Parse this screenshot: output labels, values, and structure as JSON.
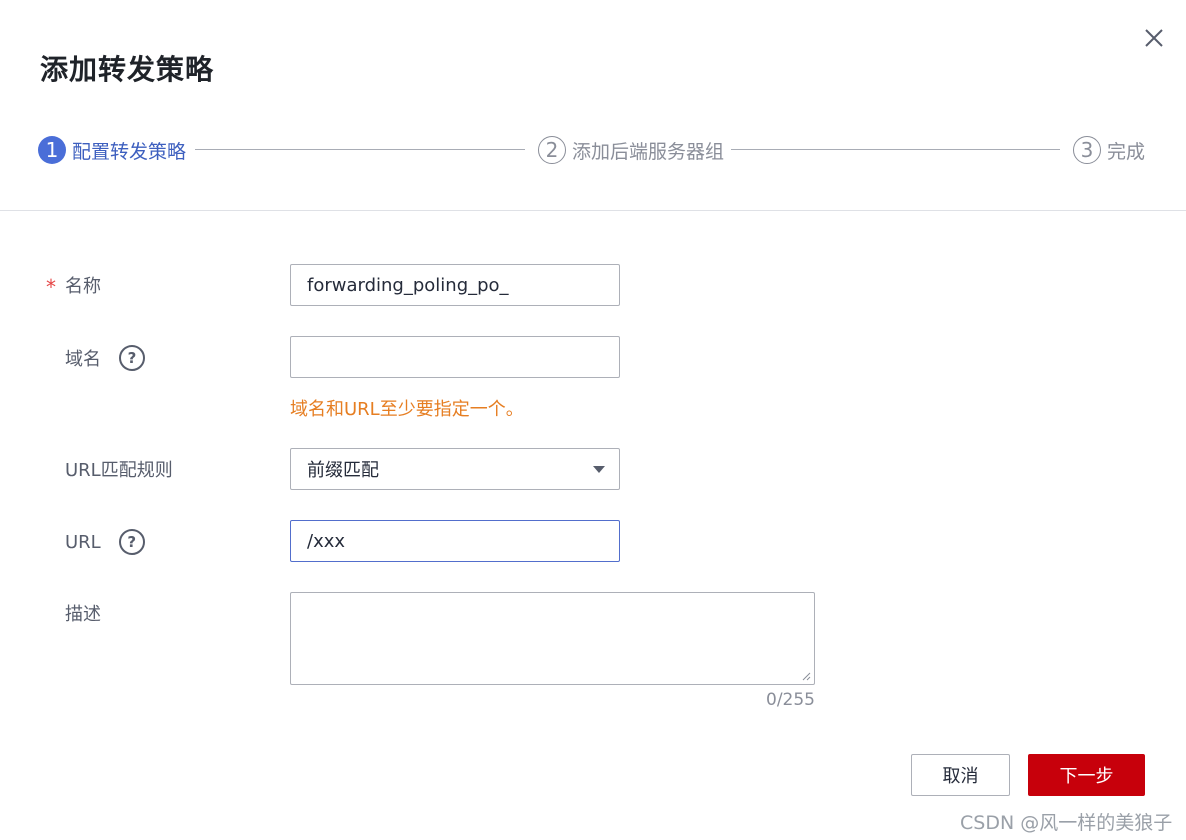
{
  "dialog": {
    "title": "添加转发策略",
    "close_icon": "close-icon"
  },
  "steps": [
    {
      "number": "1",
      "label": "配置转发策略",
      "state": "active"
    },
    {
      "number": "2",
      "label": "添加后端服务器组",
      "state": "inactive"
    },
    {
      "number": "3",
      "label": "完成",
      "state": "inactive"
    }
  ],
  "form": {
    "name": {
      "required_mark": "*",
      "label": "名称",
      "value": "forwarding_poling_po_"
    },
    "domain": {
      "label": "域名",
      "help_icon": "question-icon",
      "value": "",
      "hint": "域名和URL至少要指定一个。"
    },
    "url_match_rule": {
      "label": "URL匹配规则",
      "value": "前缀匹配"
    },
    "url": {
      "label": "URL",
      "help_icon": "question-icon",
      "value": "/xxx"
    },
    "description": {
      "label": "描述",
      "value": "",
      "counter": "0/255"
    }
  },
  "actions": {
    "cancel_label": "取消",
    "next_label": "下一步"
  },
  "watermark": "CSDN @风一样的美狼子",
  "colors": {
    "accent": "#4a6ed8",
    "primary_button": "#c7000b",
    "hint": "#e67e22",
    "required": "#e54545"
  }
}
